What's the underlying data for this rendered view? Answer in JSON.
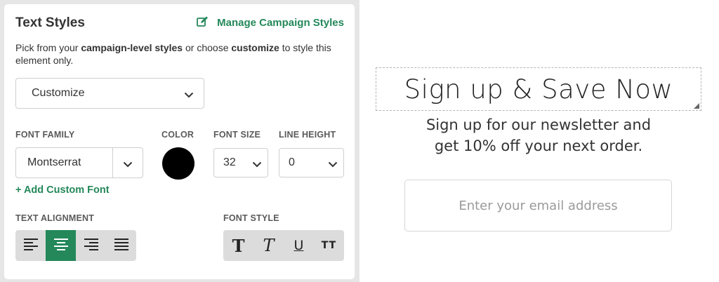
{
  "panel": {
    "title": "Text Styles",
    "manage_link": "Manage Campaign Styles",
    "description": {
      "part1": "Pick from your ",
      "bold1": "campaign-level styles",
      "part2": " or choose ",
      "bold2": "customize",
      "part3": " to style this element only."
    },
    "style_select_value": "Customize",
    "font_family": {
      "label": "FONT FAMILY",
      "value": "Montserrat"
    },
    "color": {
      "label": "COLOR",
      "value": "#000000"
    },
    "font_size": {
      "label": "FONT SIZE",
      "value": "32"
    },
    "line_height": {
      "label": "LINE HEIGHT",
      "value": "0"
    },
    "add_custom_font": "+ Add Custom Font",
    "text_alignment": {
      "label": "TEXT ALIGNMENT",
      "options": [
        "align-left-icon",
        "align-center-icon",
        "align-right-icon",
        "align-justify-icon"
      ],
      "selected": "align-center-icon"
    },
    "font_style": {
      "label": "FONT STYLE",
      "options": [
        "bold-icon",
        "italic-icon",
        "underline-icon",
        "uppercase-icon"
      ]
    }
  },
  "preview": {
    "headline": "Sign up & Save Now",
    "subtext_line1": "Sign up for our newsletter and",
    "subtext_line2": "get 10% off your next order.",
    "email_placeholder": "Enter your email address"
  },
  "colors": {
    "accent": "#24885a",
    "panel_background": "#e6e6e6",
    "swatch": "#000000"
  }
}
